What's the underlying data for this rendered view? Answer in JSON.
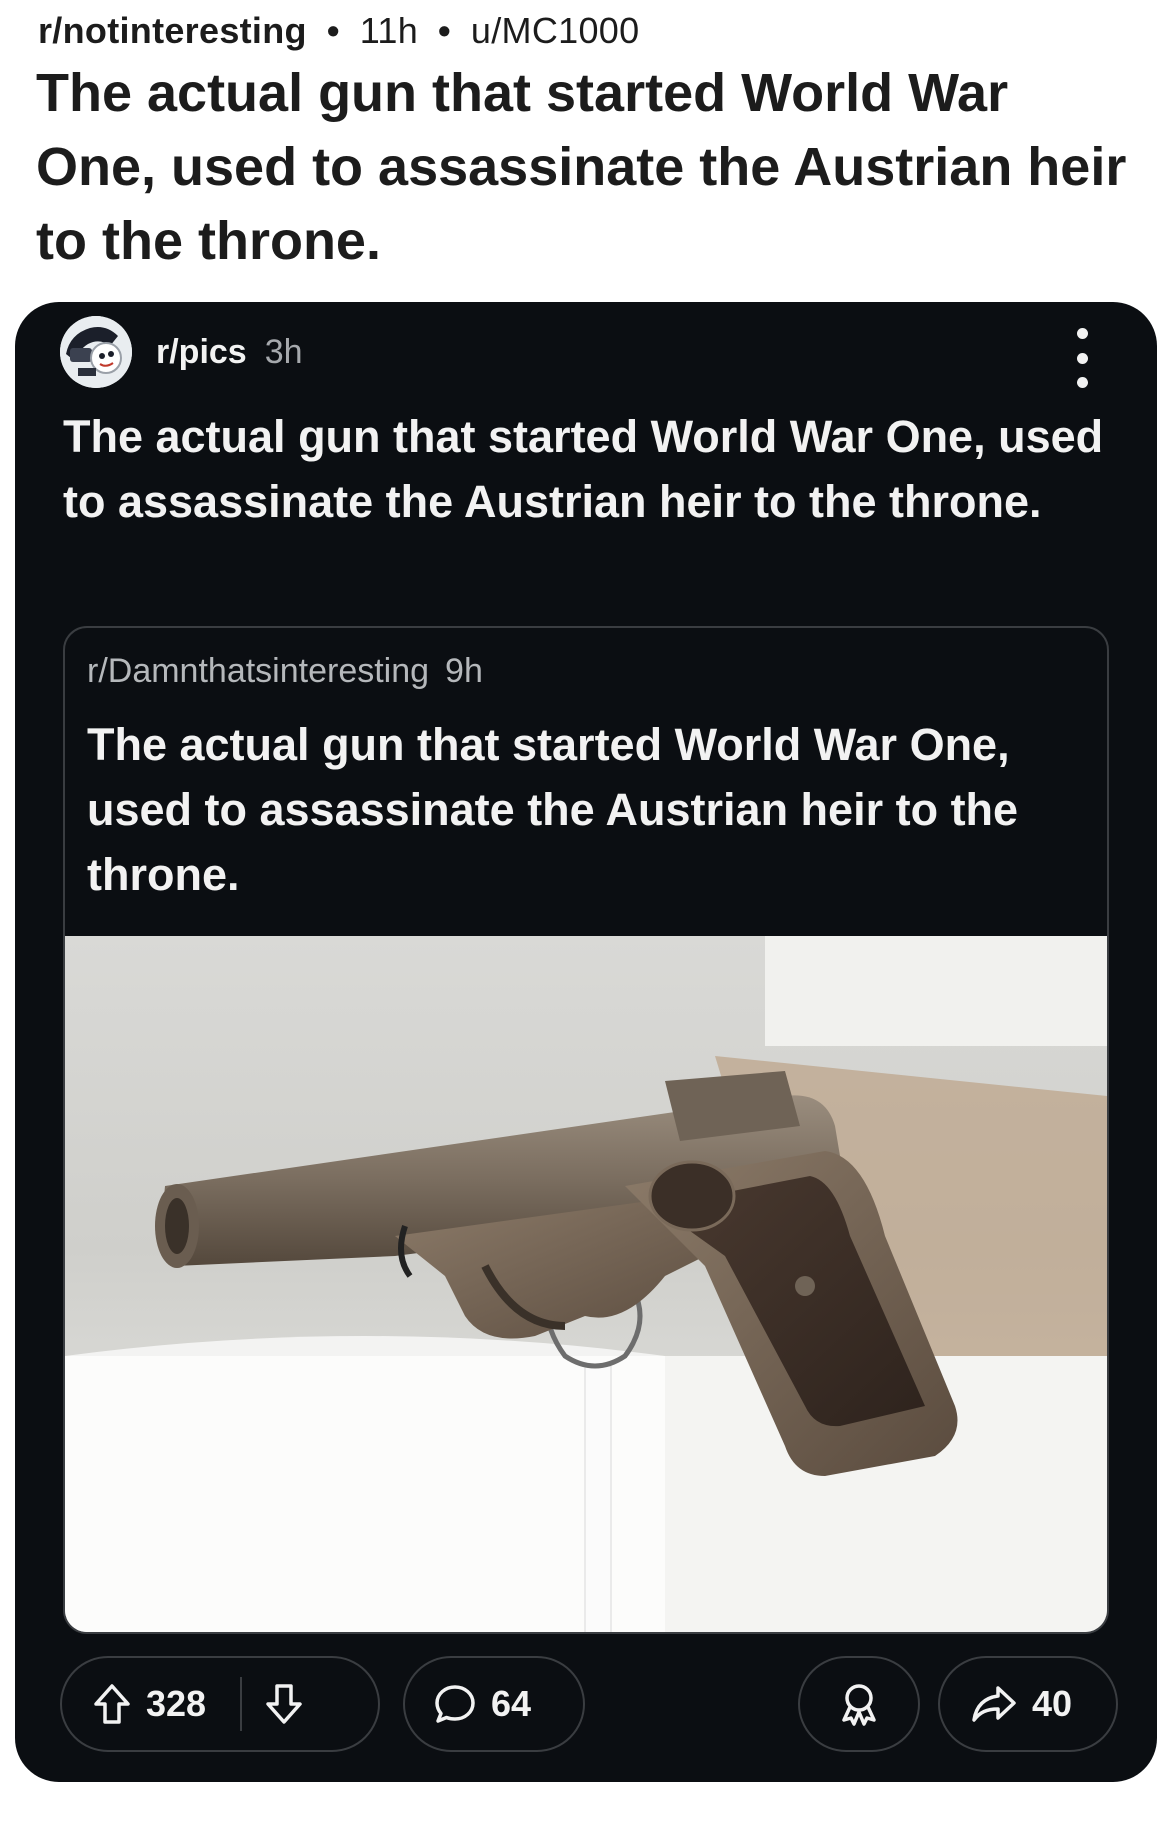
{
  "post": {
    "subreddit": "r/notinteresting",
    "age": "11h",
    "author": "u/MC1000",
    "separator": "•",
    "title": "The actual gun that started World War One, used to assassinate the Austrian heir to the throne."
  },
  "embed": {
    "subreddit": "r/pics",
    "age": "3h",
    "title": "The actual gun that started World War One, used to assassinate the Austrian heir to the throne.",
    "crosspost": {
      "subreddit": "r/Damnthatsinteresting",
      "age": "9h",
      "title": "The actual gun that started World War One, used to assassinate the Austrian heir to the throne."
    },
    "actions": {
      "upvotes": "328",
      "comments": "64",
      "shares": "40"
    }
  },
  "icons": {
    "more": "more-vertical-icon",
    "upvote": "arrow-up-icon",
    "downvote": "arrow-down-icon",
    "comment": "speech-bubble-icon",
    "award": "award-icon",
    "share": "share-arrow-icon"
  },
  "colors": {
    "card_background": "#0b0e12",
    "page_background": "#ffffff",
    "text_light": "#f2f2f2",
    "text_muted": "#a6a9ad",
    "border": "#3a3d41"
  }
}
